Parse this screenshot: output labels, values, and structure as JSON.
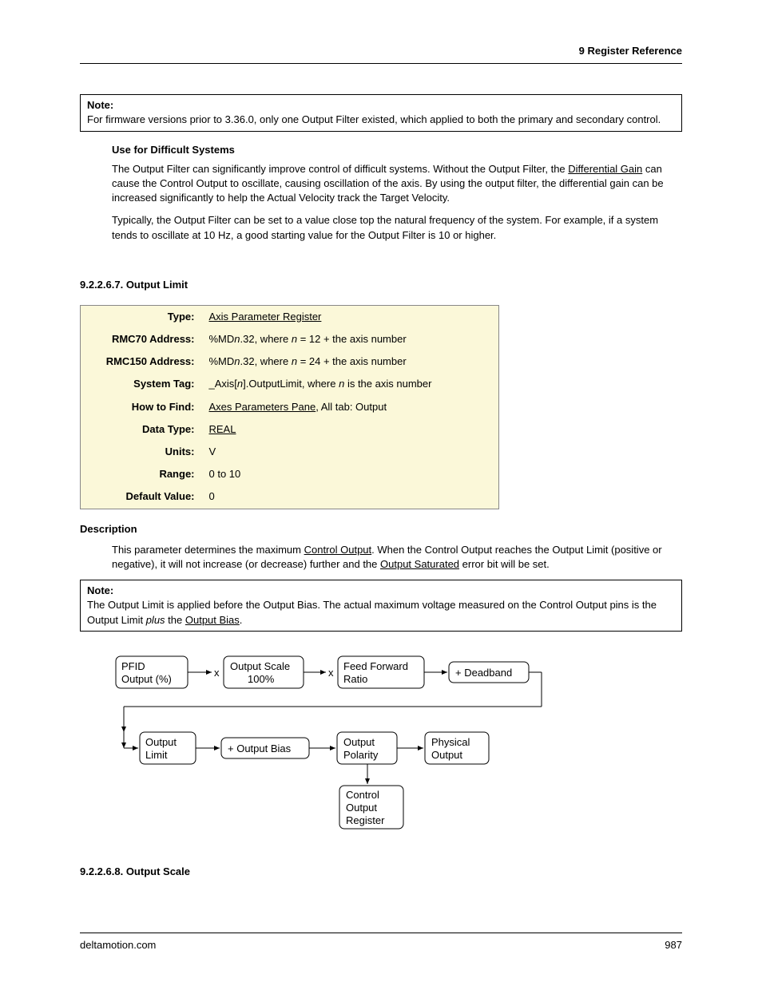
{
  "header": {
    "chapter": "9  Register Reference"
  },
  "note1": {
    "title": "Note:",
    "body_a": "For firmware versions prior to 3.36.0, only one Output Filter existed, which applied to both the primary and secondary control."
  },
  "difficult": {
    "heading": "Use for Difficult Systems",
    "p1a": "The Output Filter can significantly improve control of difficult systems. Without the Output Filter, the ",
    "p1b": "Differential Gain",
    "p1c": " can cause the Control Output to oscillate, causing oscillation of the axis. By using the output filter, the differential gain can be increased significantly to help the Actual Velocity track the Target Velocity.",
    "p2": "Typically, the Output Filter can be set to a value close top the natural frequency of the system. For example, if a system tends to oscillate at 10 Hz, a good starting value for the Output Filter is 10 or higher."
  },
  "section7": {
    "num": "9.2.2.6.7. Output Limit",
    "rows": {
      "type_label": "Type:",
      "type_val": "Axis Parameter Register",
      "rmc70_label": "RMC70 Address:",
      "rmc70_a": "%MD",
      "rmc70_b": "n",
      "rmc70_c": ".32, where ",
      "rmc70_d": "n",
      "rmc70_e": " = 12 + the axis number",
      "rmc150_label": "RMC150 Address:",
      "rmc150_a": "%MD",
      "rmc150_b": "n",
      "rmc150_c": ".32, where ",
      "rmc150_d": "n",
      "rmc150_e": " = 24 + the axis number",
      "systag_label": "System Tag:",
      "systag_a": "_Axis[",
      "systag_b": "n",
      "systag_c": "].OutputLimit, where ",
      "systag_d": "n",
      "systag_e": " is the axis number",
      "howto_label": "How to Find:",
      "howto_a": "Axes Parameters Pane",
      "howto_b": ", All tab: Output",
      "datatype_label": "Data Type:",
      "datatype_val": "REAL",
      "units_label": "Units:",
      "units_val": "V",
      "range_label": "Range:",
      "range_val": "0 to 10",
      "default_label": "Default Value:",
      "default_val": "0"
    }
  },
  "desc": {
    "heading": "Description",
    "p1a": "This parameter determines the maximum ",
    "p1b": "Control Output",
    "p1c": ". When the Control Output reaches the Output Limit (positive or negative), it will not increase (or decrease) further and the ",
    "p1d": "Output Saturated",
    "p1e": " error bit will be set."
  },
  "note2": {
    "title": "Note:",
    "a": "The Output Limit is applied before the Output Bias. The actual maximum voltage measured on the Control Output pins is the Output Limit ",
    "b": "plus",
    "c": " the ",
    "d": "Output Bias",
    "e": "."
  },
  "diagram": {
    "b1a": "PFID",
    "b1b": "Output (%)",
    "b2a": "Output Scale",
    "b2b": "100%",
    "mult": "x",
    "b3a": "Feed Forward",
    "b3b": "Ratio",
    "b4": "+ Deadband",
    "b5a": "Output",
    "b5b": "Limit",
    "b6": "+ Output Bias",
    "b7a": "Output",
    "b7b": "Polarity",
    "b8a": "Physical",
    "b8b": "Output",
    "b9a": "Control",
    "b9b": "Output",
    "b9c": "Register"
  },
  "section8": {
    "num": "9.2.2.6.8. Output Scale"
  },
  "footer": {
    "site": "deltamotion.com",
    "page": "987"
  }
}
